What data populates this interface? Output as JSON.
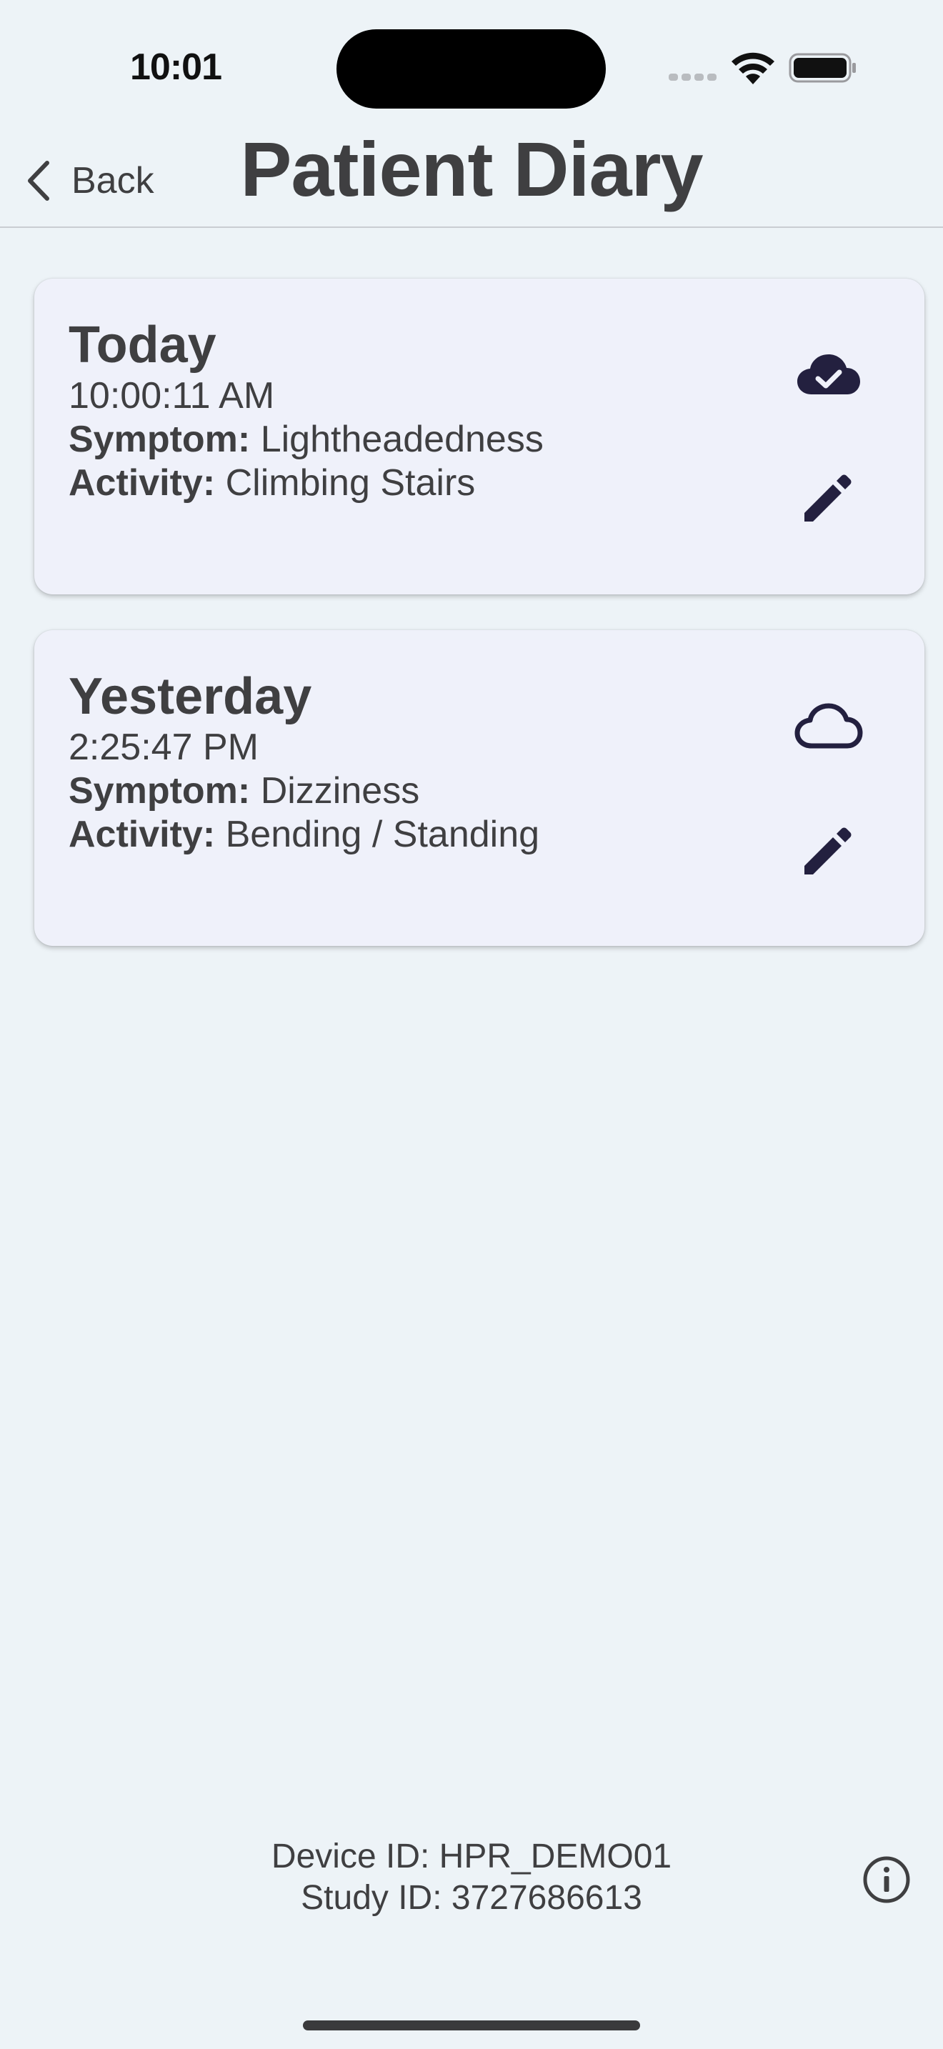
{
  "status_bar": {
    "time": "10:01"
  },
  "nav": {
    "back_label": "Back",
    "title": "Patient Diary"
  },
  "colors": {
    "background": "#edf3f7",
    "card_background": "#eff1fa",
    "icon": "#23203f",
    "text": "#3f3f41"
  },
  "entries": [
    {
      "day": "Today",
      "time": "10:00:11 AM",
      "symptom_label": "Symptom:",
      "symptom": "Lightheadedness",
      "activity_label": "Activity:",
      "activity": "Climbing Stairs",
      "sync_icon": "cloud-check-icon",
      "edit_icon": "pencil-icon"
    },
    {
      "day": "Yesterday",
      "time": "2:25:47 PM",
      "symptom_label": "Symptom:",
      "symptom": "Dizziness",
      "activity_label": "Activity:",
      "activity": "Bending / Standing",
      "sync_icon": "cloud-outline-icon",
      "edit_icon": "pencil-icon"
    }
  ],
  "footer": {
    "device_id": "Device ID: HPR_DEMO01",
    "study_id": "Study ID: 3727686613",
    "info_icon": "info-icon"
  }
}
